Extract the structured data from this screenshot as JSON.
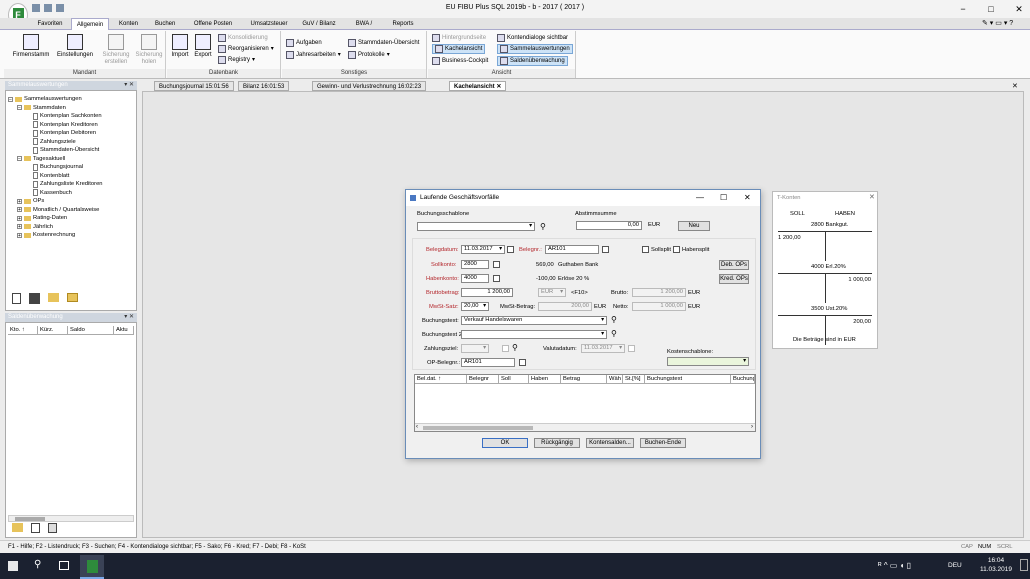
{
  "app": {
    "title": "EU FIBU Plus SQL 2019b - b - 2017 ( 2017 )"
  },
  "ribbon": {
    "tabs": [
      "Favoriten",
      "Allgemein",
      "Konten",
      "Buchen",
      "Offene Posten",
      "Umsatzsteuer",
      "GuV / Bilanz",
      "BWA / KR",
      "Reports"
    ],
    "groups": {
      "mandant": "Mandant",
      "datenbank": "Datenbank",
      "sonstiges": "Sonstiges",
      "ansicht": "Ansicht"
    },
    "buttons": {
      "firmenstamm": "Firmenstamm",
      "einstellungen": "Einstellungen",
      "sicherung_erstellen": "Sicherung erstellen",
      "sicherung_holen": "Sicherung holen",
      "import": "Import",
      "export": "Export",
      "konsolidierung": "Konsolidierung",
      "reorganisieren": "Reorganisieren",
      "registry": "Registry",
      "aufgaben": "Aufgaben",
      "jahresarbeiten": "Jahresarbeiten",
      "stammdaten_uebersicht": "Stammdaten-Übersicht",
      "protokolle": "Protokolle",
      "hintergrundseite": "Hintergrundseite",
      "kachelansicht": "Kachelansicht",
      "business_cockpit": "Business-Cockpit",
      "kontendialoge": "Kontendialoge sichtbar",
      "sammelauswertungen": "Sammelauswertungen",
      "saldenueberwachung": "Saldenüberwachung"
    }
  },
  "sidebar": {
    "title": "Sammelauswertungen",
    "tree": [
      {
        "label": "Sammelauswertungen",
        "level": 0,
        "type": "folder",
        "pm": "−"
      },
      {
        "label": "Stammdaten",
        "level": 1,
        "type": "folder",
        "pm": "−"
      },
      {
        "label": "Kontenplan Sachkonten",
        "level": 2,
        "type": "doc"
      },
      {
        "label": "Kontenplan Kreditoren",
        "level": 2,
        "type": "doc"
      },
      {
        "label": "Kontenplan Debitoren",
        "level": 2,
        "type": "doc"
      },
      {
        "label": "Zahlungsziele",
        "level": 2,
        "type": "doc"
      },
      {
        "label": "Stammdaten-Übersicht",
        "level": 2,
        "type": "doc"
      },
      {
        "label": "Tagesaktuell",
        "level": 1,
        "type": "folder",
        "pm": "−"
      },
      {
        "label": "Buchungsjournal",
        "level": 2,
        "type": "doc"
      },
      {
        "label": "Kontenblatt",
        "level": 2,
        "type": "doc"
      },
      {
        "label": "Zahlungsliste Kreditoren",
        "level": 2,
        "type": "doc"
      },
      {
        "label": "Kassenbuch",
        "level": 2,
        "type": "doc"
      },
      {
        "label": "OPs",
        "level": 1,
        "type": "folder",
        "pm": "+"
      },
      {
        "label": "Monatlich / Quartalsweise",
        "level": 1,
        "type": "folder",
        "pm": "+"
      },
      {
        "label": "Rating-Daten",
        "level": 1,
        "type": "folder",
        "pm": "+"
      },
      {
        "label": "Jährlich",
        "level": 1,
        "type": "folder",
        "pm": "+"
      },
      {
        "label": "Kostenrechnung",
        "level": 1,
        "type": "folder",
        "pm": "+"
      }
    ]
  },
  "salden": {
    "title": "Saldenüberwachung",
    "columns": [
      "Kto.",
      "Kürz.",
      "Saldo",
      "Aktu"
    ]
  },
  "doctabs": [
    "Buchungsjournal 15:01:56",
    "Bilanz 16:01:53",
    "Gewinn- und Verlustrechnung 16:02:23",
    "Kachelansicht"
  ],
  "dialog": {
    "title": "Laufende Geschäftsvorfälle",
    "buchungsschablone_label": "Buchungsschablone",
    "abstimmsumme_label": "Abstimmsumme",
    "abstimmsumme_value": "0,00",
    "currency": "EUR",
    "neu": "Neu",
    "belegdatum_label": "Belegdatum:",
    "belegdatum": "11.03.2017",
    "belegnr_label": "Belegnr.:",
    "belegnr": "AR101",
    "sollsplit": "Sollsplit",
    "habensplit": "Habensplit",
    "sollkonto_label": "Sollkonto:",
    "sollkonto": "2800",
    "soll_saldo": "569,00",
    "soll_name": "Guthaben Bank",
    "habenkonto_label": "Habenkonto:",
    "habenkonto": "4000",
    "haben_saldo": "-100,00",
    "haben_name": "Erlöse 20 %",
    "deb_ops": "Deb. OPs",
    "kred_ops": "Kred. OPs",
    "bruttobetrag_label": "Bruttobetrag:",
    "bruttobetrag": "1 200,00",
    "eur_select": "EUR",
    "f10": "<F10>",
    "brutto_label": "Brutto:",
    "brutto": "1 200,00",
    "mwst_satz_label": "MwSt-Satz:",
    "mwst_satz": "20,00",
    "mwst_betrag_label": "MwSt-Betrag:",
    "mwst_betrag": "200,00",
    "netto_label": "Netto:",
    "netto": "1 000,00",
    "buchungstext_label": "Buchungstext:",
    "buchungstext": "Verkauf Handelswaren",
    "buchungstext2_label": "Buchungstext 2:",
    "zahlungsziel_label": "Zahlungsziel:",
    "valutadatum_label": "Valutadatum:",
    "valutadatum": "11.03.2017",
    "kostenschablone_label": "Kostenschablone:",
    "op_belegnr_label": "OP-Belegnr.:",
    "op_belegnr": "AR101",
    "grid_columns": [
      "Bel.dat.",
      "Belegnr",
      "Soll",
      "Haben",
      "Betrag",
      "Wäh",
      "St.[%]",
      "Buchungstext",
      "Buchung"
    ],
    "buttons": {
      "ok": "OK",
      "rueckgaengig": "Rückgängig",
      "kontensalden": "Kontensalden...",
      "buchen_ende": "Buchen-Ende"
    }
  },
  "tkonten": {
    "title": "T-Konten",
    "soll": "SOLL",
    "haben": "HABEN",
    "accounts": [
      {
        "name": "2800 Bankgut.",
        "soll": "1 200,00",
        "haben": ""
      },
      {
        "name": "4000 Erl.20%",
        "soll": "",
        "haben": "1 000,00"
      },
      {
        "name": "3500 Ust.20%",
        "soll": "",
        "haben": "200,00"
      }
    ],
    "footer": "Die Beträge sind in EUR"
  },
  "statusbar": {
    "text": "F1 - Hilfe; F2 - Listendruck; F3 - Suchen; F4 - Kontendialoge sichtbar; F5 - Sako; F6 - Kred; F7 - Debi; F8 - KoSt",
    "cap": "CAP",
    "num": "NUM",
    "scrl": "SCRL"
  },
  "taskbar": {
    "lang": "DEU",
    "time": "16:04",
    "date": "11.03.2019"
  }
}
